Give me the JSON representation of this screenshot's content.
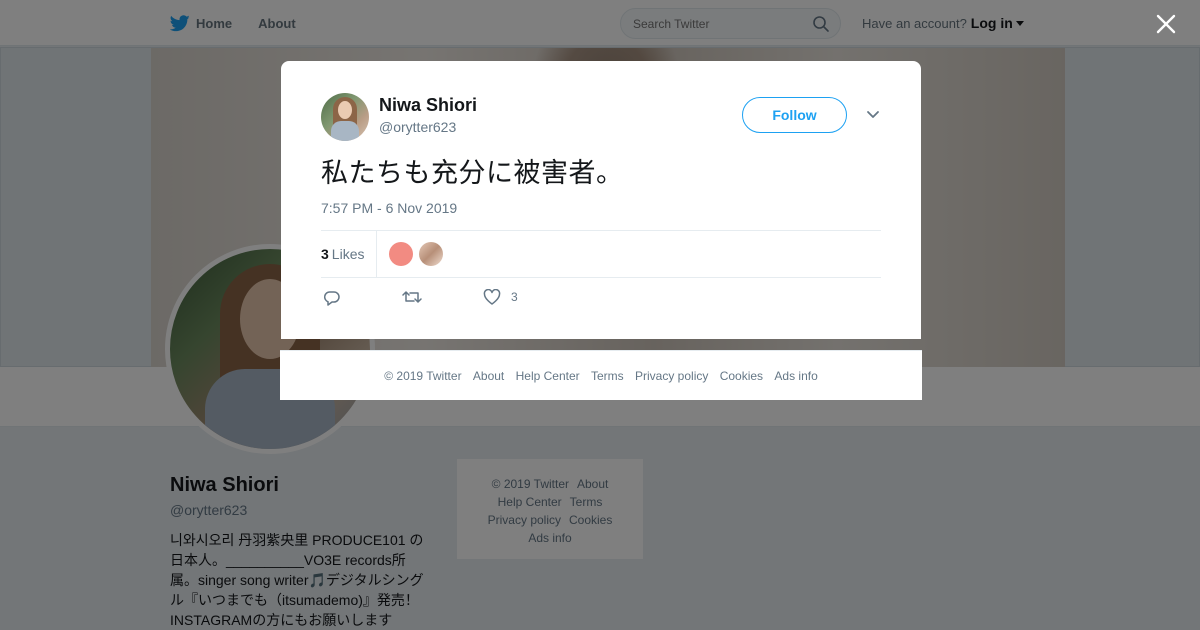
{
  "nav": {
    "home_label": "Home",
    "about_label": "About",
    "search_placeholder": "Search Twitter",
    "account_prompt": "Have an account?",
    "login_label": "Log in"
  },
  "profile": {
    "name": "Niwa Shiori",
    "handle": "@orytter623",
    "bio": "니와시오리 丹羽紫央里 PRODUCE101 の日本人。__________VO3E records所属。singer song writer🎵デジタルシングル『いつまでも（itsumademo)』発売！INSTAGRAMの方にもお願いします"
  },
  "side_footer": {
    "copyright": "© 2019 Twitter",
    "about": "About",
    "help": "Help Center",
    "terms": "Terms",
    "privacy": "Privacy policy",
    "cookies": "Cookies",
    "ads": "Ads info"
  },
  "tweet": {
    "fullname": "Niwa Shiori",
    "handle": "@orytter623",
    "follow_label": "Follow",
    "text": "私たちも充分に被害者。",
    "timestamp": "7:57 PM - 6 Nov 2019",
    "likes_count": "3",
    "likes_label": "Likes",
    "like_action_count": "3"
  },
  "modal_footer": {
    "copyright": "© 2019 Twitter",
    "about": "About",
    "help": "Help Center",
    "terms": "Terms",
    "privacy": "Privacy policy",
    "cookies": "Cookies",
    "ads": "Ads info"
  },
  "colors": {
    "accent": "#1da1f2",
    "text_secondary": "#657786",
    "overlay": "rgba(0,0,0,0.5)"
  },
  "icons": [
    "twitter-bird-icon",
    "home-icon",
    "search-icon",
    "caret-down-icon",
    "close-icon",
    "chevron-down-icon",
    "reply-icon",
    "retweet-icon",
    "heart-icon"
  ]
}
